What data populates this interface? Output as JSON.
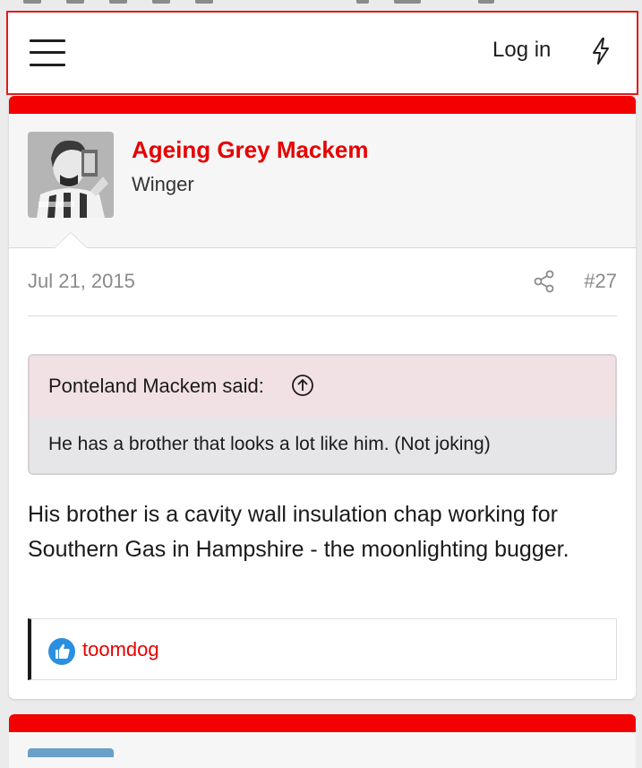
{
  "header": {
    "login_label": "Log in"
  },
  "post": {
    "username": "Ageing Grey Mackem",
    "user_title": "Winger",
    "date": "Jul 21, 2015",
    "post_number": "#27",
    "quote": {
      "author": "Ponteland Mackem said:",
      "text": "He has a brother that looks a lot like him. (Not joking)"
    },
    "body": "His brother is a cavity wall insulation chap working for Southern Gas in Hampshire - the moonlighting bugger.",
    "reactions": {
      "users": "toomdog"
    }
  },
  "colors": {
    "accent": "#e60000",
    "stripe": "#f30000",
    "quote_head_bg": "#f2e1e4",
    "quote_body_bg": "#e6e6e9",
    "like_blue": "#2b8fe0"
  },
  "icons": {
    "menu": "hamburger-icon",
    "whats_new": "bolt-icon",
    "share": "share-icon",
    "quote_jump": "arrow-up-circle-icon",
    "reaction": "like-icon"
  }
}
